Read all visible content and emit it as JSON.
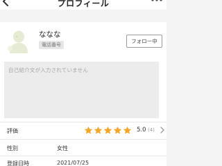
{
  "header": {
    "title": "プロフィール",
    "back_icon": "chevron-left-icon",
    "more_icon": "more-dots-icon"
  },
  "profile": {
    "name": "ななな",
    "badge": "電話番号",
    "follow_label": "フォロー中",
    "intro_placeholder": "自己紹介文が入力されていません",
    "avatar_icon": "default-avatar-icon"
  },
  "rating": {
    "label": "評価",
    "score": "5.0",
    "count": "(4)",
    "stars": 5,
    "star_color": "#f5a623"
  },
  "gender": {
    "label": "性別",
    "value": "女性"
  },
  "registered": {
    "label": "登録日時",
    "value": "2021/07/25"
  }
}
